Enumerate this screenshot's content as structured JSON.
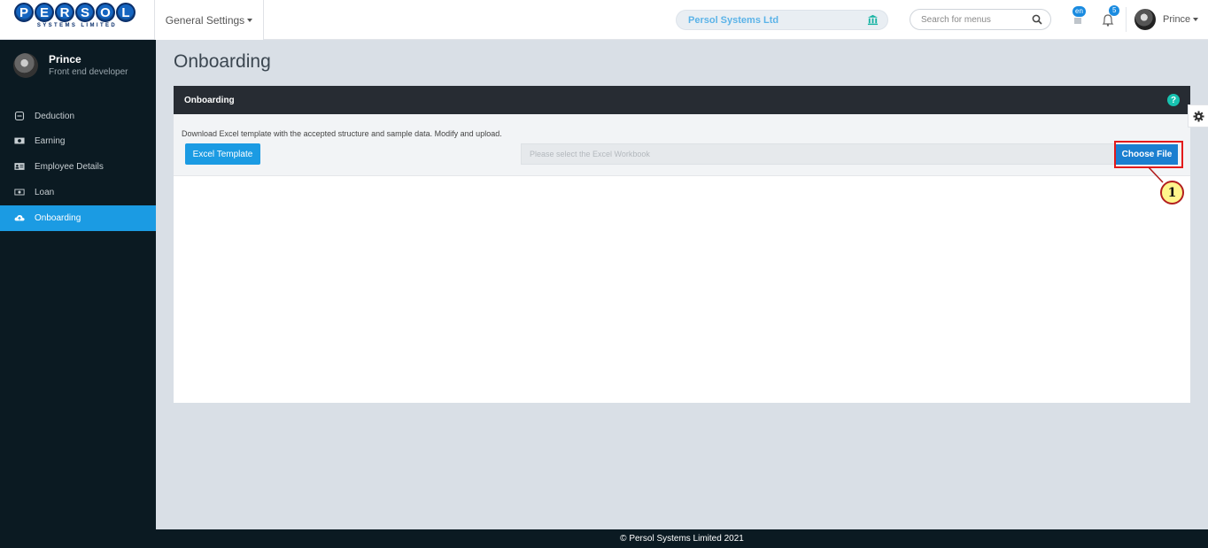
{
  "logo": {
    "letters": [
      "P",
      "E",
      "R",
      "S",
      "O",
      "L"
    ],
    "subtitle": "SYSTEMS LIMITED"
  },
  "header": {
    "settings_menu": "General Settings",
    "company": "Persol Systems Ltd",
    "search_placeholder": "Search for menus",
    "language_badge": "en",
    "notifications_count": "5",
    "user_name": "Prince"
  },
  "profile": {
    "name": "Prince",
    "role": "Front end developer"
  },
  "sidebar": {
    "items": [
      {
        "label": "Deduction",
        "icon": "minus-square-icon",
        "active": false
      },
      {
        "label": "Earning",
        "icon": "money-icon",
        "active": false
      },
      {
        "label": "Employee Details",
        "icon": "id-card-icon",
        "active": false
      },
      {
        "label": "Loan",
        "icon": "cash-icon",
        "active": false
      },
      {
        "label": "Onboarding",
        "icon": "cloud-upload-icon",
        "active": true
      }
    ]
  },
  "main": {
    "page_title": "Onboarding",
    "panel_title": "Onboarding",
    "instructions": "Download Excel template with the accepted structure and sample data. Modify and upload.",
    "template_button": "Excel Template",
    "file_placeholder": "Please select the Excel Workbook",
    "choose_button": "Choose File",
    "callout": "1"
  },
  "footer": {
    "text": "© Persol Systems Limited 2021"
  },
  "colors": {
    "accent": "#1b9be3",
    "sidebar": "#0b1a22",
    "panel_header": "#272c33",
    "highlight": "#e31b1b"
  }
}
